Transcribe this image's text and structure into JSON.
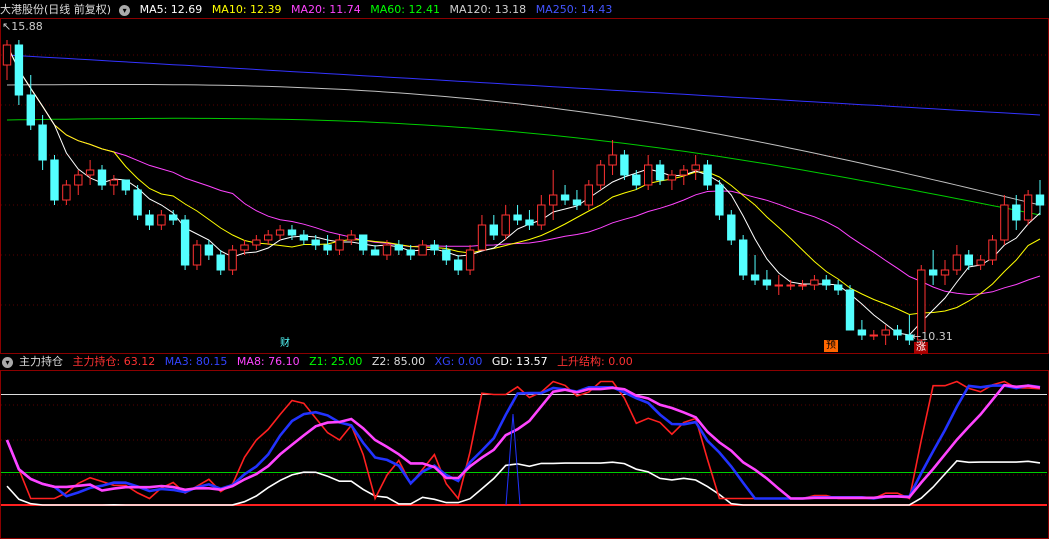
{
  "main_legend": {
    "name": "大港股份",
    "mode": "(日线 前复权)",
    "ma5": "MA5: 12.69",
    "ma10": "MA10: 12.39",
    "ma20": "MA20: 11.74",
    "ma60": "MA60: 12.41",
    "ma120": "MA120: 13.18",
    "ma250": "MA250: 14.43"
  },
  "sub_legend": {
    "name": "主力持仓",
    "zlcc": "主力持仓: 63.12",
    "ma3": "MA3: 80.15",
    "ma8": "MA8: 76.10",
    "z1": "Z1: 25.00",
    "z2": "Z2: 85.00",
    "xg": "XG: 0.00",
    "gd": "GD: 13.57",
    "ssjg": "上升结构: 0.00"
  },
  "labels": {
    "high": "15.88",
    "low": "10.31",
    "cai": "财",
    "yu": "预",
    "zhang": "涨"
  },
  "colors": {
    "up": "#ff3232",
    "down": "#54ffff",
    "ma5": "#ffffff",
    "ma10": "#ffff00",
    "ma20": "#ff44ff",
    "ma60": "#00cc00",
    "ma120": "#c0c0c0",
    "ma250": "#3333ff"
  },
  "chart_data": {
    "type": "candlestick",
    "price_range": [
      9.8,
      16.3
    ],
    "candles": [
      [
        15.4,
        15.9,
        15.1,
        15.8
      ],
      [
        15.8,
        15.9,
        14.6,
        14.8
      ],
      [
        14.8,
        15.2,
        14.1,
        14.2
      ],
      [
        14.2,
        14.4,
        13.3,
        13.5
      ],
      [
        13.5,
        13.6,
        12.6,
        12.7
      ],
      [
        12.7,
        13.1,
        12.6,
        13.0
      ],
      [
        13.0,
        13.3,
        12.8,
        13.2
      ],
      [
        13.2,
        13.5,
        13.0,
        13.3
      ],
      [
        13.3,
        13.4,
        12.9,
        13.0
      ],
      [
        13.0,
        13.2,
        12.8,
        13.1
      ],
      [
        13.1,
        13.1,
        12.8,
        12.9
      ],
      [
        12.9,
        13.0,
        12.3,
        12.4
      ],
      [
        12.4,
        12.5,
        12.1,
        12.2
      ],
      [
        12.2,
        12.5,
        12.1,
        12.4
      ],
      [
        12.4,
        12.5,
        12.2,
        12.3
      ],
      [
        12.3,
        12.4,
        11.3,
        11.4
      ],
      [
        11.4,
        11.9,
        11.3,
        11.8
      ],
      [
        11.8,
        11.9,
        11.5,
        11.6
      ],
      [
        11.6,
        11.7,
        11.2,
        11.3
      ],
      [
        11.3,
        11.8,
        11.2,
        11.7
      ],
      [
        11.7,
        11.9,
        11.6,
        11.8
      ],
      [
        11.8,
        12.0,
        11.7,
        11.9
      ],
      [
        11.9,
        12.1,
        11.8,
        12.0
      ],
      [
        12.0,
        12.2,
        11.9,
        12.1
      ],
      [
        12.1,
        12.2,
        11.9,
        12.0
      ],
      [
        12.0,
        12.1,
        11.8,
        11.9
      ],
      [
        11.9,
        12.0,
        11.7,
        11.8
      ],
      [
        11.8,
        12.0,
        11.6,
        11.7
      ],
      [
        11.7,
        12.0,
        11.6,
        11.9
      ],
      [
        11.9,
        12.1,
        11.8,
        12.0
      ],
      [
        12.0,
        12.0,
        11.6,
        11.7
      ],
      [
        11.7,
        11.8,
        11.6,
        11.6
      ],
      [
        11.6,
        11.9,
        11.5,
        11.8
      ],
      [
        11.8,
        11.9,
        11.6,
        11.7
      ],
      [
        11.7,
        11.8,
        11.5,
        11.6
      ],
      [
        11.6,
        11.9,
        11.6,
        11.8
      ],
      [
        11.8,
        11.9,
        11.6,
        11.7
      ],
      [
        11.7,
        11.8,
        11.4,
        11.5
      ],
      [
        11.5,
        11.6,
        11.2,
        11.3
      ],
      [
        11.3,
        11.8,
        11.2,
        11.7
      ],
      [
        11.7,
        12.4,
        11.7,
        12.2
      ],
      [
        12.2,
        12.4,
        11.9,
        12.0
      ],
      [
        12.0,
        12.6,
        11.9,
        12.4
      ],
      [
        12.4,
        12.6,
        12.2,
        12.3
      ],
      [
        12.3,
        12.5,
        12.1,
        12.2
      ],
      [
        12.2,
        12.8,
        12.1,
        12.6
      ],
      [
        12.6,
        13.3,
        12.3,
        12.8
      ],
      [
        12.8,
        13.0,
        12.6,
        12.7
      ],
      [
        12.7,
        12.9,
        12.5,
        12.6
      ],
      [
        12.6,
        13.1,
        12.5,
        13.0
      ],
      [
        13.0,
        13.5,
        12.9,
        13.4
      ],
      [
        13.4,
        13.9,
        13.2,
        13.6
      ],
      [
        13.6,
        13.7,
        13.1,
        13.2
      ],
      [
        13.2,
        13.3,
        12.9,
        13.0
      ],
      [
        13.0,
        13.6,
        12.9,
        13.4
      ],
      [
        13.4,
        13.5,
        13.0,
        13.1
      ],
      [
        13.1,
        13.3,
        12.9,
        13.2
      ],
      [
        13.2,
        13.4,
        13.0,
        13.3
      ],
      [
        13.3,
        13.6,
        13.1,
        13.4
      ],
      [
        13.4,
        13.5,
        12.9,
        13.0
      ],
      [
        13.0,
        13.1,
        12.3,
        12.4
      ],
      [
        12.4,
        12.5,
        11.8,
        11.9
      ],
      [
        11.9,
        12.0,
        11.1,
        11.2
      ],
      [
        11.2,
        11.6,
        11.0,
        11.1
      ],
      [
        11.1,
        11.3,
        10.9,
        11.0
      ],
      [
        11.0,
        11.2,
        10.8,
        11.0
      ],
      [
        11.0,
        11.1,
        10.9,
        11.0
      ],
      [
        11.0,
        11.1,
        10.9,
        11.0
      ],
      [
        11.0,
        11.2,
        10.9,
        11.1
      ],
      [
        11.1,
        11.2,
        10.9,
        11.0
      ],
      [
        11.0,
        11.1,
        10.8,
        10.9
      ],
      [
        10.9,
        11.0,
        10.1,
        10.1
      ],
      [
        10.1,
        10.3,
        9.9,
        10.0
      ],
      [
        10.0,
        10.1,
        9.9,
        10.0
      ],
      [
        10.0,
        10.2,
        9.8,
        10.1
      ],
      [
        10.1,
        10.2,
        9.9,
        10.0
      ],
      [
        10.0,
        10.4,
        9.8,
        9.9
      ],
      [
        9.9,
        11.4,
        9.6,
        11.3
      ],
      [
        11.3,
        11.7,
        11.0,
        11.2
      ],
      [
        11.2,
        11.5,
        11.0,
        11.3
      ],
      [
        11.3,
        11.8,
        11.2,
        11.6
      ],
      [
        11.6,
        11.7,
        11.3,
        11.4
      ],
      [
        11.4,
        11.6,
        11.3,
        11.5
      ],
      [
        11.5,
        12.0,
        11.4,
        11.9
      ],
      [
        11.9,
        12.8,
        11.8,
        12.6
      ],
      [
        12.6,
        12.8,
        12.1,
        12.3
      ],
      [
        12.3,
        12.9,
        12.2,
        12.8
      ],
      [
        12.8,
        13.1,
        12.4,
        12.6
      ]
    ]
  }
}
